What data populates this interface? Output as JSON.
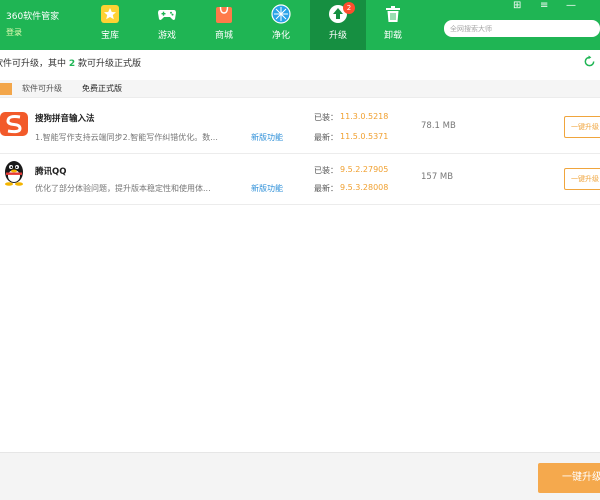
{
  "app": {
    "title": "360软件管家",
    "login": "登录"
  },
  "nav": [
    {
      "label": "宝库",
      "icon": "star-icon"
    },
    {
      "label": "游戏",
      "icon": "gamepad-icon"
    },
    {
      "label": "商城",
      "icon": "shopping-bag-icon"
    },
    {
      "label": "净化",
      "icon": "shield-icon"
    },
    {
      "label": "升级",
      "icon": "upgrade-arrow-icon",
      "badge": "2",
      "active": true
    },
    {
      "label": "卸载",
      "icon": "trash-icon"
    }
  ],
  "window_controls": {
    "grid": "⊞",
    "menu": "≡",
    "minimize": "—"
  },
  "search": {
    "placeholder": "全网搜索大师"
  },
  "summary": {
    "before": "软件可升级，其中 ",
    "count": "2",
    "after": " 款可升级正式版"
  },
  "filters": {
    "all": "软件可升级",
    "free": "免费正式版"
  },
  "apps": [
    {
      "name": "搜狗拼音输入法",
      "desc": "1.智能写作支持云端同步2.智能写作纠错优化。数...",
      "feature": "新版功能",
      "installed_label": "已装：",
      "installed": "11.3.0.5218",
      "latest_label": "最新：",
      "latest": "11.5.0.5371",
      "size": "78.1 MB",
      "button": "一键升级"
    },
    {
      "name": "腾讯QQ",
      "desc": "优化了部分体验问题，提升版本稳定性和使用体...",
      "feature": "新版功能",
      "installed_label": "已装：",
      "installed": "9.5.2.27905",
      "latest_label": "最新：",
      "latest": "9.5.3.28008",
      "size": "157 MB",
      "button": "一键升级"
    }
  ],
  "footer": {
    "button": "一键升级"
  },
  "colors": {
    "header": "#1fb554",
    "accent": "#f0a53d",
    "link": "#2d8fd8"
  }
}
